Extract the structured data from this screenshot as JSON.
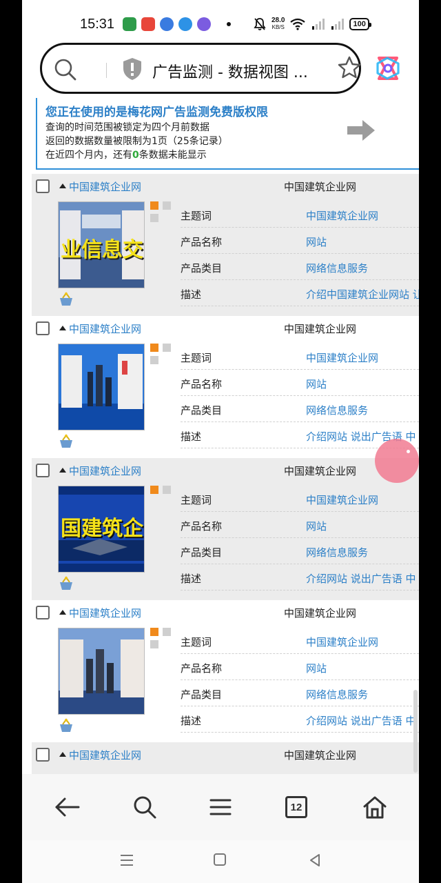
{
  "status_bar": {
    "time": "15:31",
    "net_speed": "28.0",
    "net_unit": "KB/S",
    "battery": "100"
  },
  "address_bar": {
    "title": "广告监测 - 数据视图 ..."
  },
  "notice": {
    "title": "您正在使用的是梅花网广告监测免费版权限",
    "line1": "查询的时间范围被锁定为四个月前数据",
    "line2": "返回的数据数量被限制为1页（25条记录）",
    "line3_pre": "在近四个月内，还有",
    "line3_count": "0",
    "line3_post": "条数据未能显示"
  },
  "records": [
    {
      "site": "中国建筑企业网",
      "advertiser": "中国建筑企业网",
      "thumb_text": "业信息交",
      "fields": [
        {
          "label": "主题词",
          "value": "中国建筑企业网"
        },
        {
          "label": "产品名称",
          "value": "网站"
        },
        {
          "label": "产品类目",
          "value": "网络信息服务"
        },
        {
          "label": "描述",
          "value": "介绍中国建筑企业网站 让"
        }
      ]
    },
    {
      "site": "中国建筑企业网",
      "advertiser": "中国建筑企业网",
      "thumb_text": "",
      "fields": [
        {
          "label": "主题词",
          "value": "中国建筑企业网"
        },
        {
          "label": "产品名称",
          "value": "网站"
        },
        {
          "label": "产品类目",
          "value": "网络信息服务"
        },
        {
          "label": "描述",
          "value": "介绍网站 说出广告语 中"
        }
      ]
    },
    {
      "site": "中国建筑企业网",
      "advertiser": "中国建筑企业网",
      "thumb_text": "国建筑企",
      "fields": [
        {
          "label": "主题词",
          "value": "中国建筑企业网"
        },
        {
          "label": "产品名称",
          "value": "网站"
        },
        {
          "label": "产品类目",
          "value": "网络信息服务"
        },
        {
          "label": "描述",
          "value": "介绍网站 说出广告语 中"
        }
      ]
    },
    {
      "site": "中国建筑企业网",
      "advertiser": "中国建筑企业网",
      "thumb_text": "",
      "fields": [
        {
          "label": "主题词",
          "value": "中国建筑企业网"
        },
        {
          "label": "产品名称",
          "value": "网站"
        },
        {
          "label": "产品类目",
          "value": "网络信息服务"
        },
        {
          "label": "描述",
          "value": "介绍网站 说出广告语 中"
        }
      ]
    },
    {
      "site": "中国建筑企业网",
      "advertiser": "中国建筑企业网",
      "thumb_text": "",
      "fields": []
    }
  ],
  "bottom_nav": {
    "tab_count": "12"
  },
  "icons": {
    "search": "search-icon",
    "shield": "shield-icon",
    "star": "star-icon",
    "app": "multi-app-icon",
    "back": "back-arrow-icon",
    "menu": "menu-icon",
    "tabs": "tabs-icon",
    "home": "home-icon"
  },
  "colors": {
    "link": "#2b7fc7",
    "notice_border": "#2d8fd8",
    "zero_count": "#2ea83a",
    "orange_square": "#f08a1c",
    "row_gray": "#ececec"
  }
}
